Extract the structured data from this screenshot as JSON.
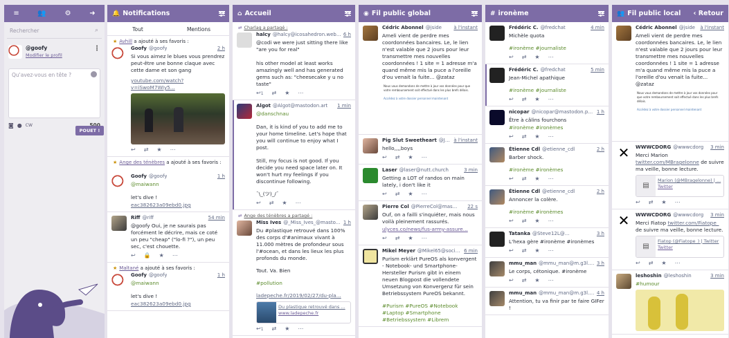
{
  "nav": {
    "search_placeholder": "Rechercher",
    "account_name": "@goofy",
    "account_edit": "Modifier le profil",
    "compose_placeholder": "Qu'avez-vous en tête ?",
    "cw": "CW",
    "char_count": "500",
    "toot": "POUET !"
  },
  "columns": {
    "notifications": {
      "title": "Notifications",
      "tabs": [
        "Tout",
        "Mentions"
      ],
      "items": [
        {
          "line_user": "Avhill",
          "line_text": " a ajouté à ses favoris :",
          "name": "Goofy",
          "handle": "@goofy",
          "time": "2 h",
          "text": "Si vous aimez le blues vous prendrez peut-être une bonne claque avec cette dame et son gang",
          "link": "youtube.com/watch?v=iSwoM7WIy5..."
        },
        {
          "line_user": "Ange des ténèbres",
          "line_text": " a ajouté à ses favoris :",
          "name": "Goofy",
          "handle": "@goofy",
          "time": "1 h",
          "text1": "@maiwann",
          "text2": "let's dive !",
          "link": "eac382623a09ebd0.jpg"
        },
        {
          "name": "Riff",
          "handle": "@riff",
          "time": "54 min",
          "text": "@goofy Oui, je ne saurais pas forcément le décrire, mais ce coté un peu \"cheap\" (\"lo-fi ?\"), un peu sec, c'est chouette."
        },
        {
          "line_user": "Maltané",
          "line_text": " a ajouté à ses favoris :",
          "name": "Goofy",
          "handle": "@goofy",
          "time": "1 h",
          "text1": "@maiwann",
          "text2": "let's dive !",
          "link": "eac382623a09ebd0.jpg"
        }
      ]
    },
    "home": {
      "title": "Accueil",
      "items": [
        {
          "boost": "Charlag a partagé :",
          "name": "halcy",
          "handle": "@halcy@icosahedron.web...",
          "time": "6 h",
          "text1": "@codi we were just sitting there like \"are you for real\"",
          "text2": "his other model at least works amazingly well and has generated gems such as: \"cheesecake y u no taste\"",
          "reply": "1"
        },
        {
          "name": "Algot",
          "handle": "@Algot@mastodon.art",
          "time": "1 min",
          "text1": "@danschnau",
          "text2": "Dan, it is kind of you to add me to your home timeline. Let's hope that you will continue to enjoy what I post.",
          "text3": "Still, my focus is not good. If you decide you need space later on. It won't hurt my feelings if you discontinue following.",
          "text4": "¯\\_(ツ)_/¯"
        },
        {
          "boost": "Ange des ténèbres a partagé :",
          "name": "Miss Ives",
          "handle": "@_Miss_Ives_@masto...",
          "time": "1 h",
          "text1": "Du #plastique retrouvé dans 100% des corps d'#animaux vivant à 11.000 mètres de profondeur sous l'#ocean, et dans les lieux les plus profonds du monde.",
          "text2": "Tout. Va. Bien",
          "text3": "#pollution",
          "link": "ladepeche.fr/2019/02/27/du-pla...",
          "card_title": "Du plastique retrouvé dans ...",
          "card_site": "www.ladepeche.fr",
          "reply": "1"
        }
      ]
    },
    "public": {
      "title": "Fil public global",
      "items": [
        {
          "name": "Cédric Abonnel",
          "handle": "@jside",
          "time": "à l'instant",
          "text": "Ameli vient de perdre mes coordonnées bancaires. Le, le lien n'est valable que 2 jours pour leur transmettre mes nouvelles coordonnées ! 1 site = 1 adresse m'a quand même mis la puce a l'oreille d'ou venait la fuite... @zataz"
        },
        {
          "name": "Pig Slut Sweetheart",
          "handle": "@Jessic...",
          "time": "à l'instant",
          "text": "hello,,,,boys"
        },
        {
          "name": "Laser",
          "handle": "@laser@nutt.church",
          "time": "3 min",
          "text": "Getting a LOT of randos on main lately, i don't like it"
        },
        {
          "name": "Pierre Col",
          "handle": "@PierreCol@mas...",
          "time": "22 s",
          "text": "Ouf, on a failli s'inquiéter, mais nous voilà pleinement rassurés.",
          "link": "ulyces.co/news/fus-army-assure..."
        },
        {
          "name": "Mikel Meyer",
          "handle": "@Mikel65@social.tc...",
          "time": "6 min",
          "text": "Purism erklärt PureOS als konvergent - Notebook- und Smartphone-Hersteller Purism gibt in einem neuen Blogpost die vollendete Umsetzung von Konvergenz für sein Betriebssystem PureOS bekannt.",
          "tags": "#Purism #PureOS #Notebook #Laptop #Smartphone #Betriebssystem #Librem"
        }
      ]
    },
    "ironeme": {
      "title": "ironème",
      "items": [
        {
          "name": "Frédéric C.",
          "handle": "@fredchat",
          "time": "4 min",
          "text": "Michèle quota",
          "tag": "#ironème #journaliste"
        },
        {
          "name": "Frédéric C.",
          "handle": "@fredchat",
          "time": "5 min",
          "text": "Jean-Michel apathique",
          "tag": "#ironème #journaliste"
        },
        {
          "name": "nicopar",
          "handle": "@nicopar@mastodon.papey.fr",
          "time": "1 h",
          "text": "Être à câlins fourchons",
          "tag": "#ironème #ironèmes"
        },
        {
          "name": "Étienne Cdl",
          "handle": "@etienne_cdl",
          "time": "2 h",
          "text": "Barber shock.",
          "tag": "#ironème #ironèmes"
        },
        {
          "name": "Étienne Cdl",
          "handle": "@etienne_cdl",
          "time": "2 h",
          "text": "Annoncer la colère.",
          "tag": "#ironème #ironèmes"
        },
        {
          "name": "Tatanka",
          "handle": "@Steve12L@...",
          "time": "3 h",
          "text": "L'hexa gère #ironème #ironèmes"
        },
        {
          "name": "mmu_man",
          "handle": "@mmu_man@m.g3l.org",
          "time": "3 h",
          "text": "Le corps, cétonique. #ironème"
        },
        {
          "name": "mmu_man",
          "handle": "@mmu_man@m.g3l.org",
          "time": "4 h",
          "text": "Attention, tu va finir par te faire GIFer !"
        }
      ]
    },
    "local": {
      "title": "Fil public local",
      "back": "Retour",
      "items": [
        {
          "name": "Cédric Abonnel",
          "handle": "@jside",
          "time": "à l'instant",
          "text": "Ameli vient de perdre mes coordonnées bancaires. Le, le lien n'est valable que 2 jours pour leur transmettre mes nouvelles coordonnées ! 1 site = 1 adresse m'a quand même mis la puce a l'oreille d'ou venait la fuite... @zataz"
        },
        {
          "name": "WWWCDORG",
          "handle": "@wwwcdorg",
          "time": "3 min",
          "text1": "Merci Marion ",
          "link": "twitter.com/MBragelonne",
          "text2": " de suivre ma veille, bonne lecture.",
          "card_title": "Marion (@MBragelonne) | ...",
          "card_site": "Twitter"
        },
        {
          "name": "WWWCDORG",
          "handle": "@wwwcdorg",
          "time": "3 min",
          "text1": "Merci Fiatop ",
          "link": "twitter.com/Fiatope_",
          "text2": " de suivre ma veille, bonne lecture.",
          "card_title": "Fiatop (@Fiatope_) | Twitter",
          "card_site": "Twitter"
        },
        {
          "name": "leshoshin",
          "handle": "@leshoshin",
          "time": "3 min",
          "text": "#humour"
        }
      ]
    }
  },
  "doc_text": "Nous vous demandons de mettre à jour vos données pour que votre remboursement soit effectué dans les plus brefs délais.",
  "doc_link": "Accédez à votre dossier personnel maintenant"
}
